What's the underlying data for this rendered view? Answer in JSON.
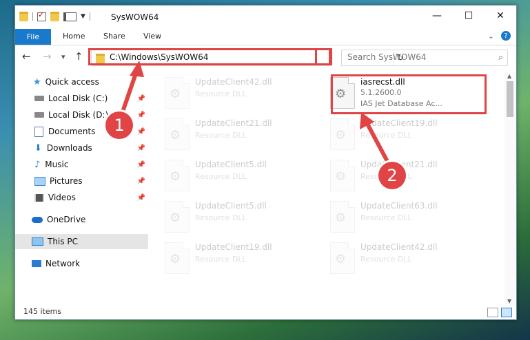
{
  "window": {
    "title": "SysWOW64",
    "minimize": "—",
    "maximize": "☐",
    "close": "✕"
  },
  "ribbon": {
    "file_tab": "File",
    "tabs": [
      "Home",
      "Share",
      "View"
    ]
  },
  "navigation": {
    "back": "←",
    "forward": "→",
    "recent": "▾",
    "up": "↑",
    "address": "C:\\Windows\\SysWOW64",
    "refresh": "↻",
    "search_placeholder": "Search SysWOW64"
  },
  "sidebar": {
    "items": [
      {
        "label": "Quick access",
        "icon": "star-icon"
      },
      {
        "label": "Local Disk (C:)",
        "icon": "drive-icon",
        "pinned": true
      },
      {
        "label": "Local Disk (D:)",
        "icon": "drive-icon",
        "pinned": true
      },
      {
        "label": "Documents",
        "icon": "documents-icon",
        "pinned": true
      },
      {
        "label": "Downloads",
        "icon": "downloads-icon",
        "pinned": true
      },
      {
        "label": "Music",
        "icon": "music-icon",
        "pinned": true
      },
      {
        "label": "Pictures",
        "icon": "pictures-icon",
        "pinned": true
      },
      {
        "label": "Videos",
        "icon": "videos-icon",
        "pinned": true
      },
      {
        "label": "OneDrive",
        "icon": "onedrive-icon"
      },
      {
        "label": "This PC",
        "icon": "computer-icon",
        "selected": true
      },
      {
        "label": "Network",
        "icon": "network-icon"
      }
    ]
  },
  "files": {
    "selected": {
      "name": "iasrecst.dll",
      "version": "5.1.2600.0",
      "description": "IAS Jet Database Ac..."
    },
    "background": [
      {
        "name": "UpdateClient42.dll",
        "type": "Resource DLL"
      },
      {
        "name": "UpdateClient21.dll",
        "type": "Resource DLL"
      },
      {
        "name": "UpdateClient19.dll",
        "type": "Resource DLL"
      },
      {
        "name": "UpdateClient5.dll",
        "type": "Resource DLL"
      },
      {
        "name": "UpdateClient21.dll",
        "type": "Resource DLL"
      },
      {
        "name": "UpdateClient5.dll",
        "type": "Resource DLL"
      },
      {
        "name": "UpdateClient63.dll",
        "type": "Resource DLL"
      },
      {
        "name": "UpdateClient19.dll",
        "type": "Resource DLL"
      },
      {
        "name": "UpdateClient42.dll",
        "type": "Resource DLL"
      }
    ]
  },
  "status": {
    "item_count": "145 items"
  },
  "callouts": {
    "step1": "1",
    "step2": "2",
    "color": "#e04444"
  }
}
